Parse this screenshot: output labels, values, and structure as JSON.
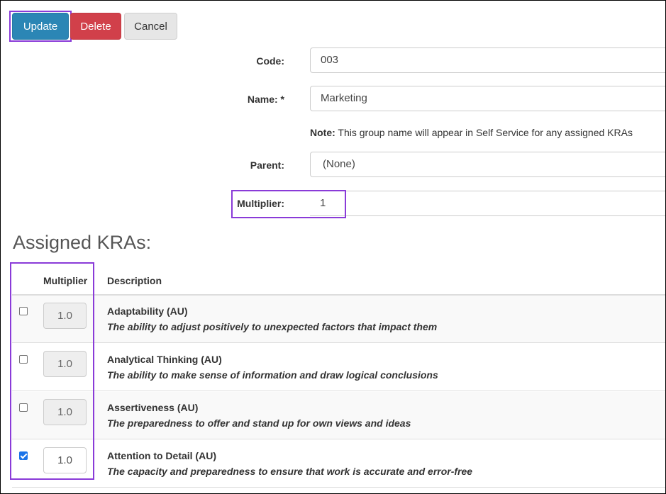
{
  "toolbar": {
    "update_label": "Update",
    "delete_label": "Delete",
    "cancel_label": "Cancel"
  },
  "form": {
    "code": {
      "label": "Code:",
      "value": "003"
    },
    "name": {
      "label": "Name: *",
      "value": "Marketing"
    },
    "note": {
      "prefix": "Note:",
      "text": " This group name will appear in Self Service for any assigned KRAs"
    },
    "parent": {
      "label": "Parent:",
      "value": "(None)"
    },
    "multiplier": {
      "label": "Multiplier:",
      "value": "1"
    }
  },
  "assigned": {
    "title": "Assigned KRAs:",
    "columns": {
      "multiplier": "Multiplier",
      "description": "Description"
    },
    "rows": [
      {
        "checked": false,
        "multiplier": "1.0",
        "name": "Adaptability (AU)",
        "description": "The ability to adjust positively to unexpected factors that impact them"
      },
      {
        "checked": false,
        "multiplier": "1.0",
        "name": "Analytical Thinking (AU)",
        "description": "The ability to make sense of information and draw logical conclusions"
      },
      {
        "checked": false,
        "multiplier": "1.0",
        "name": "Assertiveness (AU)",
        "description": "The preparedness to offer and stand up for own views and ideas"
      },
      {
        "checked": true,
        "multiplier": "1.0",
        "name": "Attention to Detail (AU)",
        "description": "The capacity and preparedness to ensure that work is accurate and error-free"
      }
    ]
  },
  "colors": {
    "primary": "#2b86b5",
    "danger": "#d1404a",
    "highlight": "#8a3bd8",
    "checkbox": "#1a73e8"
  }
}
